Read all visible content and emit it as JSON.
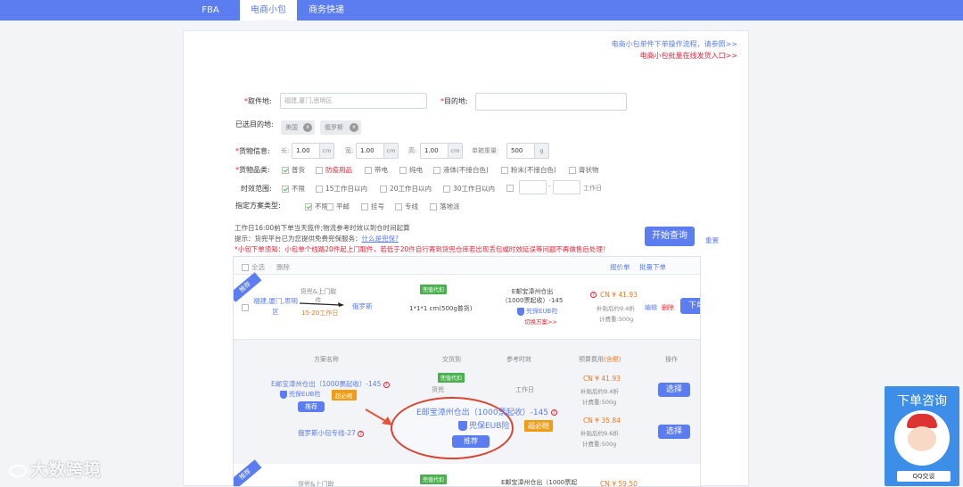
{
  "tabs": [
    {
      "label": "FBA"
    },
    {
      "label": "电商小包"
    },
    {
      "label": "商务快递"
    }
  ],
  "links": {
    "guide": "电商小包单件下单操作流程，请参照>>",
    "batch": "电商小包批量在线发货入口>>"
  },
  "form": {
    "pickup_label": "取件地:",
    "pickup_value": "福建,厦门,思明区",
    "dest_label": "目的地:",
    "selected_label": "已选目的地:",
    "chips": [
      "美国",
      "俄罗斯"
    ],
    "chip_x": "x",
    "cargo_label": "货物信息:",
    "len_label": "长:",
    "len_value": "1.00",
    "wid_label": "宽:",
    "wid_value": "1.00",
    "hei_label": "高:",
    "hei_value": "1.00",
    "unit_cm": "cm",
    "weight_label": "单箱重量:",
    "weight_value": "500",
    "unit_g": "g",
    "category_label": "货物品类:",
    "categories": [
      "普货",
      "防疫用品",
      "带电",
      "纯电",
      "液体(不接白色)",
      "粉末(不接白色)",
      "膏状物"
    ],
    "time_label": "时效范围:",
    "times": [
      "不限",
      "15工作日以内",
      "20工作日以内",
      "30工作日以内"
    ],
    "time_dash": "-",
    "time_unit": "工作日",
    "plan_label": "指定方案类型:",
    "plans": [
      "不限",
      "平邮",
      "挂号",
      "专线",
      "落地派"
    ]
  },
  "notes": {
    "line1": "工作日16:00前下单当天揽件;物流参考时效以到仓时间起算",
    "line2_prefix": "提示：货兜平台已为您提供免费兜保服务：",
    "line2_link": "什么是兜保?",
    "line3": "*小包下单须知：小包单个线路20件起上门取件，若低于20件自行寄到货兜仓库若出现丢包或时效延误等问题不再做售后处理！"
  },
  "buttons": {
    "search": "开始查询",
    "reset": "重置",
    "order": "下单",
    "select": "选择",
    "recommend": "推荐"
  },
  "table": {
    "select_all": "全选",
    "delete": "删除",
    "quote": "报价单",
    "batch_order": "批量下单",
    "ribbon": "推荐",
    "row1": {
      "from": "福建,厦门,思明区",
      "method": "货兜&上门取件",
      "days": "15-20工作日",
      "to": "俄罗斯",
      "tag": "兜值代扣",
      "size": "1*1*1 cm(500g普货)",
      "plan": "E邮宝漳州仓出（1000票起收）-145",
      "insure": "兜保EUB险",
      "switch": "切换方案>>",
      "price": "CN ¥ 41.93",
      "discount": "补贴后约9.4折",
      "weight": "计费重:500g",
      "edit": "编辑",
      "del": "删除"
    },
    "row2": {
      "method": "货兜&上门取",
      "tag": "兜值代扣",
      "plan": "E邮宝漳州仓出（1000票起",
      "price": "CN ¥ 59.50"
    }
  },
  "sub": {
    "headers": [
      "方案名称",
      "交货到",
      "参考时效",
      "预算费用",
      "(含税)",
      "操作"
    ],
    "opt1": {
      "name": "E邮宝漳州仓出（1000票起收）-145",
      "insure": "兜保EUB险",
      "badge": "超必赔",
      "tag": "兜值代扣",
      "price": "CN ¥ 41.93",
      "discount": "补贴后约9.4折",
      "weight": "计费重:500g"
    },
    "opt2": {
      "name": "俄罗斯小包专线-27",
      "price": "CN ¥ 35.84",
      "discount": "补贴后约9.6折",
      "weight": "计费重:500g"
    },
    "zoom": {
      "name": "E邮宝漳州仓出（1000票起收）-145",
      "insure": "兜保EUB险",
      "badge": "超必赔"
    },
    "partial1": "货兜",
    "partial2": "工作日"
  },
  "watermark": "大数跨境",
  "widget": {
    "title": "下单咨询",
    "qq": "QQ交谈"
  },
  "colors": {
    "primary": "#5b7df0",
    "danger": "#e23333",
    "price": "#f07820",
    "green": "#4caf50",
    "circle": "#d9432f"
  }
}
